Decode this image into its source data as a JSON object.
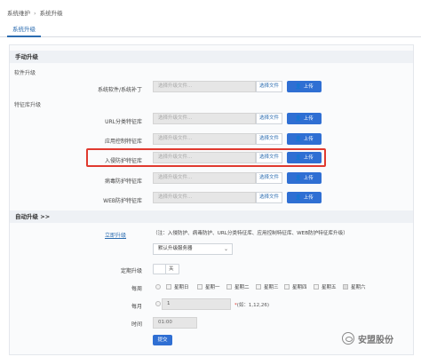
{
  "breadcrumb": [
    "系统维护",
    "系统升级"
  ],
  "tabs": [
    {
      "label": "系统升级",
      "active": true
    }
  ],
  "manual": {
    "title": "手动升级",
    "software_group": "软件升级",
    "signature_group": "特征库升级",
    "placeholder": "选择升级文件...",
    "choose_label": "选择文件",
    "upload_label": "上传",
    "rows": [
      {
        "label": "系统软件/系统补丁"
      },
      {
        "label": "URL分类特征库"
      },
      {
        "label": "应用控制特征库"
      },
      {
        "label": "入侵防护特征库",
        "highlighted": true
      },
      {
        "label": "病毒防护特征库"
      },
      {
        "label": "WEB防护特征库"
      }
    ]
  },
  "auto": {
    "title": "自动升级 >>",
    "link": "立即升级",
    "note": "（注：入侵防护、病毒防护、URL分类特征库、应用控制特征库、WEB防护特征库升级）",
    "server_value": "默认升级服务器",
    "periodic_label": "定期升级",
    "toggle_text": "关",
    "weekly_label": "每周",
    "weekdays": [
      "星期日",
      "星期一",
      "星期二",
      "星期三",
      "星期四",
      "星期五",
      "星期六"
    ],
    "monthly_label": "每月",
    "monthly_value": "1",
    "monthly_hint": "(如：1,12,26)",
    "time_label": "时间",
    "time_value": "01:00",
    "submit_label": "提交"
  },
  "watermark": "安盟股份",
  "colors": {
    "accent": "#2f6fd3",
    "highlight": "#e03a2f"
  }
}
